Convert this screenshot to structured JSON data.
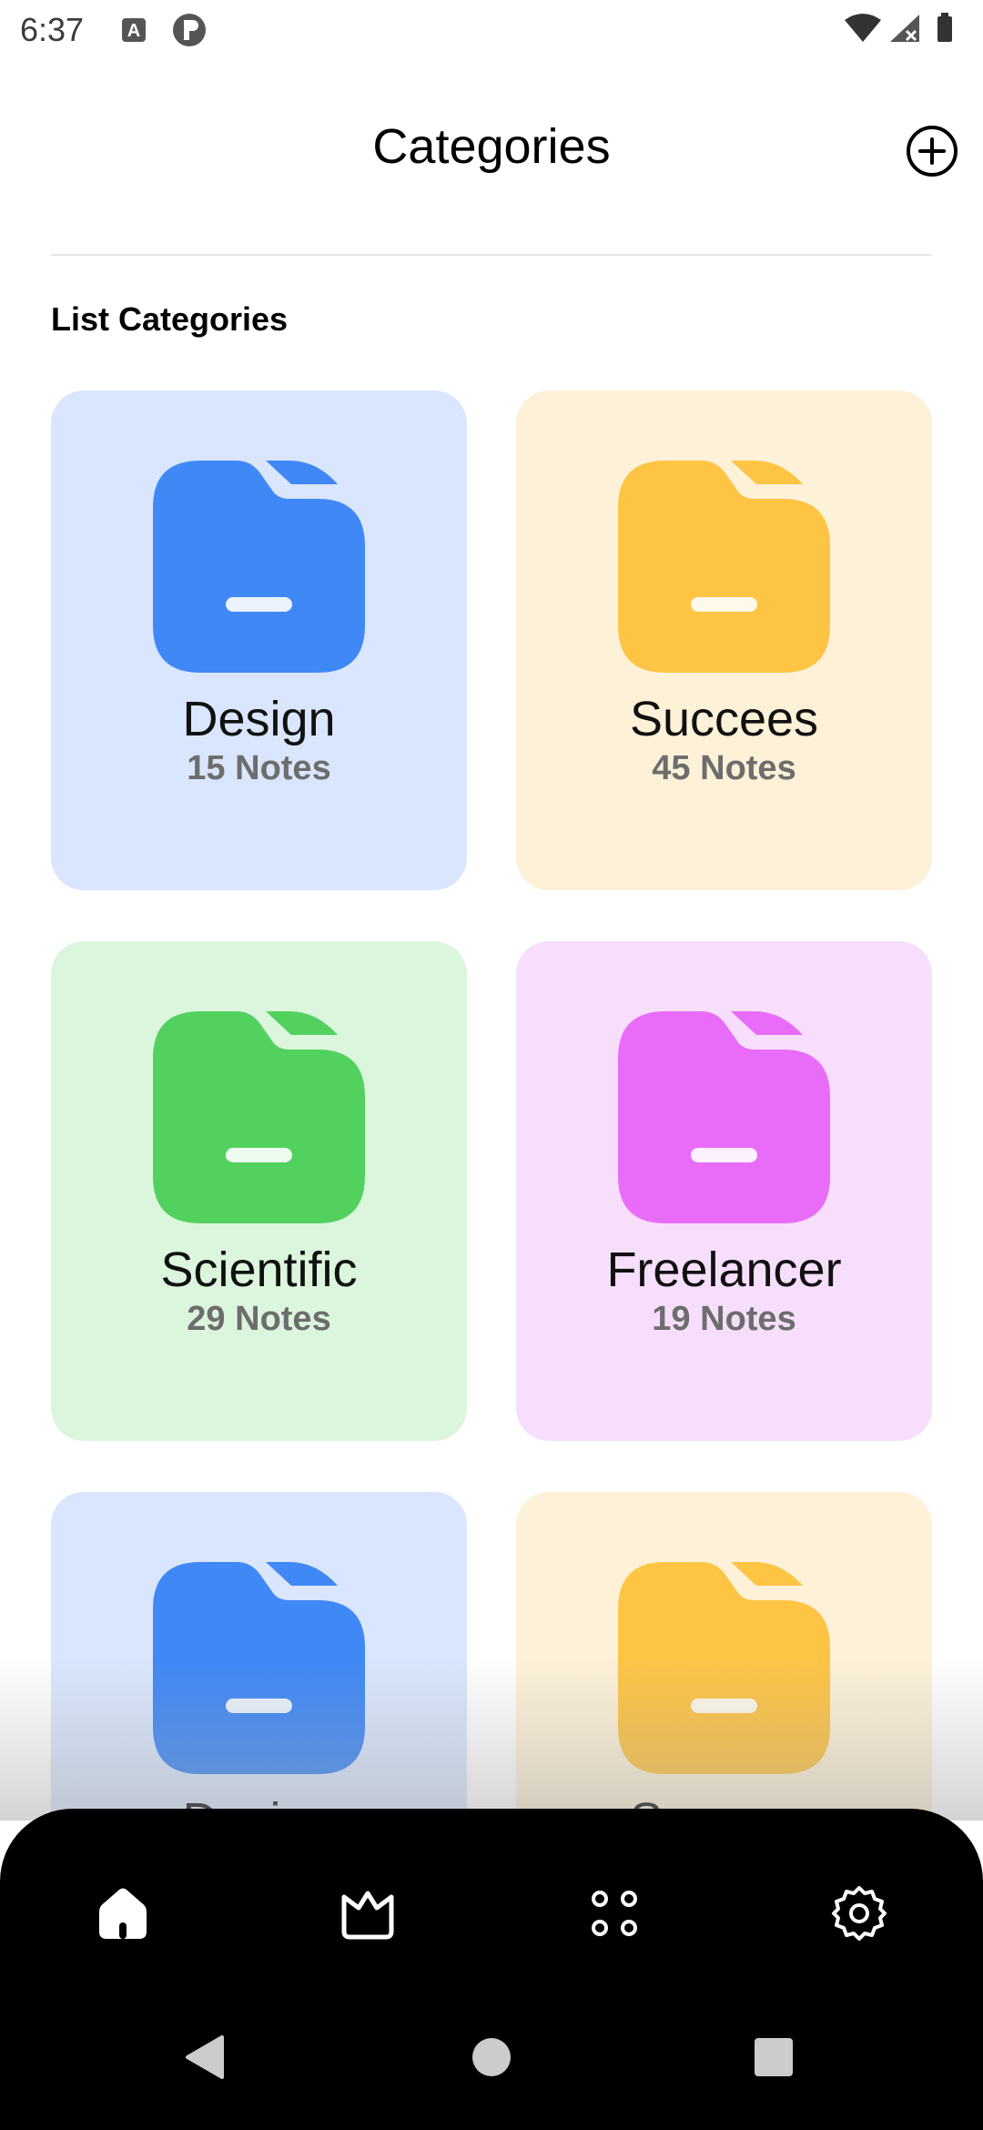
{
  "status_bar": {
    "time": "6:37"
  },
  "header": {
    "title": "Categories",
    "add_icon": "plus-circle-icon"
  },
  "section": {
    "title": "List Categories"
  },
  "colors": {
    "blue_bg": "#d9e6fd",
    "blue_icon": "#3f88f6",
    "yellow_bg": "#fdf1d8",
    "yellow_icon": "#fec444",
    "green_bg": "#dcf6dd",
    "green_icon": "#52d15e",
    "pink_bg": "#f7defc",
    "pink_icon": "#e96cf8"
  },
  "categories": [
    {
      "name": "Design",
      "count": "15 Notes",
      "color": "blue"
    },
    {
      "name": "Succees",
      "count": "45 Notes",
      "color": "yellow"
    },
    {
      "name": "Scientific",
      "count": "29 Notes",
      "color": "green"
    },
    {
      "name": "Freelancer",
      "count": "19 Notes",
      "color": "pink"
    },
    {
      "name": "Design",
      "count": "",
      "color": "blue"
    },
    {
      "name": "Succees",
      "count": "",
      "color": "yellow"
    }
  ],
  "bottom_nav": {
    "items": [
      "home-icon",
      "crown-icon",
      "apps-grid-icon",
      "settings-gear-icon"
    ],
    "active": "home-icon"
  },
  "system_nav": [
    "back-icon",
    "home-circle-icon",
    "recents-square-icon"
  ]
}
